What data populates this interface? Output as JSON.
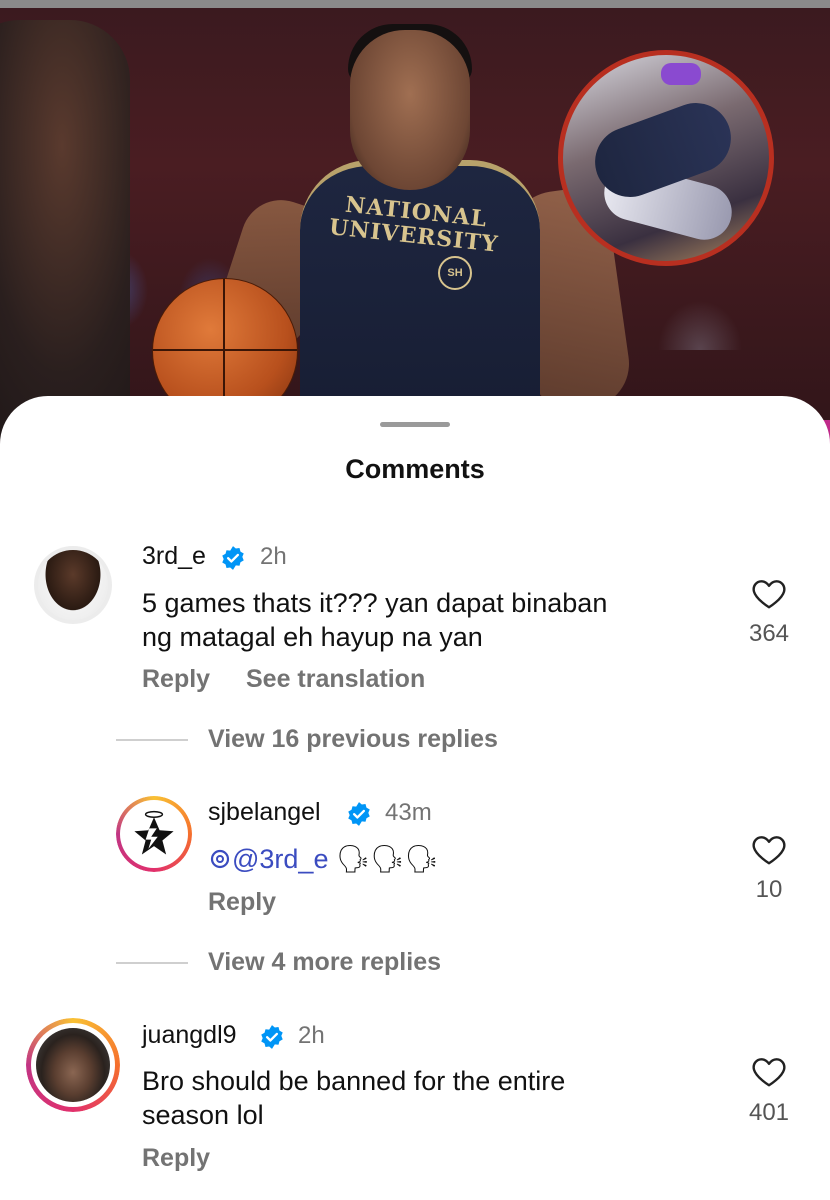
{
  "sheet": {
    "title": "Comments"
  },
  "photo": {
    "jersey_line1": "NATIONAL",
    "jersey_line2": "UNIVERSITY",
    "badge": "SH"
  },
  "comments": [
    {
      "username": "3rd_e",
      "verified": true,
      "time": "2h",
      "text_line1": "5 games thats it??? yan dapat binaban",
      "text_line2": "ng matagal eh hayup na yan",
      "reply_label": "Reply",
      "translate_label": "See translation",
      "likes": "364"
    },
    {
      "view_replies_label": "View 16 previous replies"
    },
    {
      "username": "sjbelangel",
      "verified": true,
      "time": "43m",
      "mention": "@3rd_e",
      "emojis": "🗣🗣🗣",
      "reply_label": "Reply",
      "likes": "10"
    },
    {
      "view_replies_label": "View 4 more replies"
    },
    {
      "username": "juangdl9",
      "verified": true,
      "time": "2h",
      "text_line1": "Bro should be banned for the entire",
      "text_line2": "season lol",
      "reply_label": "Reply",
      "likes": "401"
    }
  ],
  "icons": {
    "verified": "verified-badge-icon",
    "like": "heart-icon",
    "threads": "threads-icon"
  },
  "colors": {
    "verified_blue": "#0095f6",
    "mention_blue": "#3b4cc0",
    "secondary_text": "#737373"
  }
}
